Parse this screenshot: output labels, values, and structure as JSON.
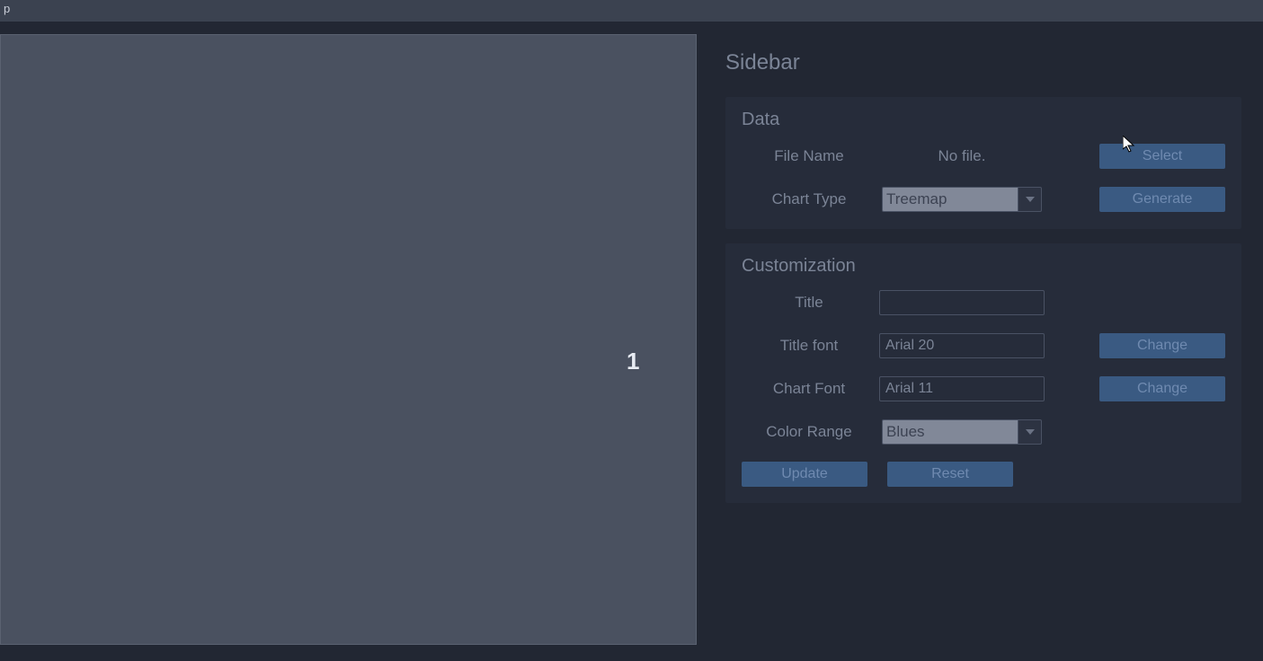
{
  "topbar": {
    "menu": "p"
  },
  "canvas": {
    "center": "1"
  },
  "sidebar": {
    "title": "Sidebar",
    "data": {
      "heading": "Data",
      "file_name_label": "File Name",
      "file_name_value": "No file.",
      "select_label": "Select",
      "chart_type_label": "Chart Type",
      "chart_type_value": "Treemap",
      "generate_label": "Generate"
    },
    "custom": {
      "heading": "Customization",
      "title_label": "Title",
      "title_value": "",
      "title_font_label": "Title font",
      "title_font_value": "Arial 20",
      "chart_font_label": "Chart Font",
      "chart_font_value": "Arial 11",
      "color_range_label": "Color Range",
      "color_range_value": "Blues",
      "change_label": "Change",
      "update_label": "Update",
      "reset_label": "Reset"
    }
  }
}
